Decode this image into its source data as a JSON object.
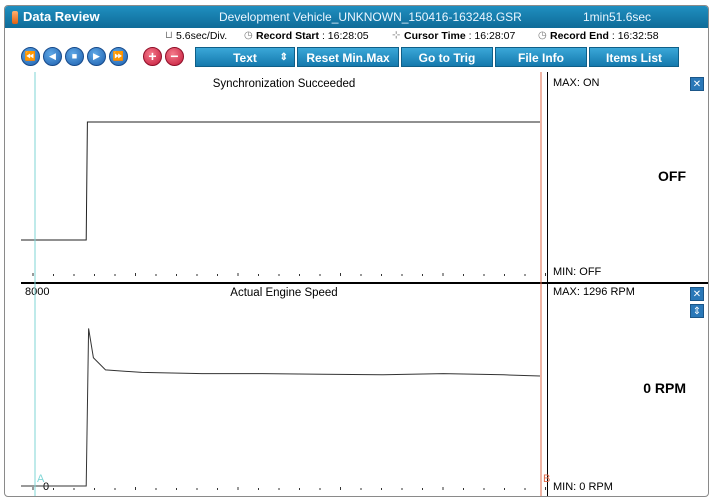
{
  "titlebar": {
    "app_title": "Data Review",
    "file_name": "Development Vehicle_UNKNOWN_150416-163248.GSR",
    "duration": "1min51.6sec"
  },
  "infoline": {
    "time_per_div": "5.6sec/Div.",
    "record_start_label": "Record Start",
    "record_start_value": ": 16:28:05",
    "cursor_time_label": "Cursor Time",
    "cursor_time_value": ": 16:28:07",
    "record_end_label": "Record End",
    "record_end_value": ": 16:32:58"
  },
  "toolbar": {
    "playback": [
      {
        "name": "rewind-button",
        "glyph": "⏪"
      },
      {
        "name": "step-back-button",
        "glyph": "◀"
      },
      {
        "name": "stop-button",
        "glyph": "■"
      },
      {
        "name": "step-forward-button",
        "glyph": "▶"
      },
      {
        "name": "fast-forward-button",
        "glyph": "⏩"
      }
    ],
    "zoom_in_glyph": "+",
    "zoom_out_glyph": "−",
    "text_label": "Text",
    "text_arrows": "⇕",
    "reset_label": "Reset Min.Max",
    "trig_label": "Go to Trig",
    "file_info_label": "File Info",
    "items_list_label": "Items List"
  },
  "panels": {
    "sync": {
      "title": "Synchronization Succeeded",
      "max_text": "MAX: ON",
      "min_text": "MIN: OFF",
      "current": "OFF",
      "close_glyph": "✕"
    },
    "engine": {
      "title": "Actual Engine Speed",
      "y_top": "8000",
      "y_bottom": "0",
      "max_text": "MAX:  1296 RPM",
      "min_text": "MIN:    0 RPM",
      "current": "0 RPM",
      "close_glyph": "✕",
      "expand_glyph": "⇕"
    }
  },
  "cursors": {
    "a_label": "A",
    "b_label": "B",
    "a_color": "#7fd6d6",
    "b_color": "#e06a4a"
  },
  "colors": {
    "title_bar": "#1679aa",
    "button": "#1f8fc4"
  },
  "chart_data": {
    "type": "line",
    "series": [
      {
        "name": "Synchronization Succeeded",
        "x": [
          0,
          10.8,
          11,
          86
        ],
        "values": [
          "OFF",
          "OFF",
          "ON",
          "ON"
        ]
      },
      {
        "name": "Actual Engine Speed",
        "ylim": [
          0,
          8000
        ],
        "x": [
          0,
          10.8,
          11.2,
          12,
          14,
          20,
          30,
          40,
          50,
          60,
          70,
          80,
          86
        ],
        "values": [
          0,
          0,
          1290,
          1050,
          950,
          930,
          920,
          920,
          915,
          910,
          920,
          910,
          900
        ]
      }
    ]
  }
}
